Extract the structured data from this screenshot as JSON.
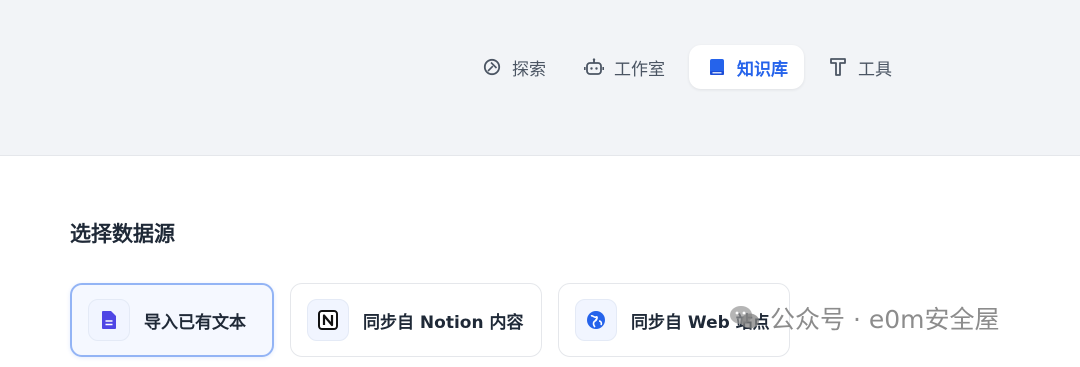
{
  "nav": {
    "items": [
      {
        "label": "探索",
        "icon": "compass-icon",
        "active": false
      },
      {
        "label": "工作室",
        "icon": "robot-icon",
        "active": false
      },
      {
        "label": "知识库",
        "icon": "book-icon",
        "active": true
      },
      {
        "label": "工具",
        "icon": "hammer-icon",
        "active": false
      }
    ]
  },
  "main": {
    "section_title": "选择数据源",
    "sources": [
      {
        "label": "导入已有文本",
        "icon": "document-icon",
        "selected": true
      },
      {
        "label": "同步自 Notion 内容",
        "icon": "notion-icon",
        "selected": false
      },
      {
        "label": "同步自 Web 站点",
        "icon": "globe-icon",
        "selected": false
      }
    ]
  },
  "watermark": {
    "text": "公众号 · e0m安全屋"
  },
  "colors": {
    "header_bg": "#f2f4f7",
    "accent": "#2563eb",
    "text": "#1f2937",
    "nav_text": "#4b5563"
  }
}
